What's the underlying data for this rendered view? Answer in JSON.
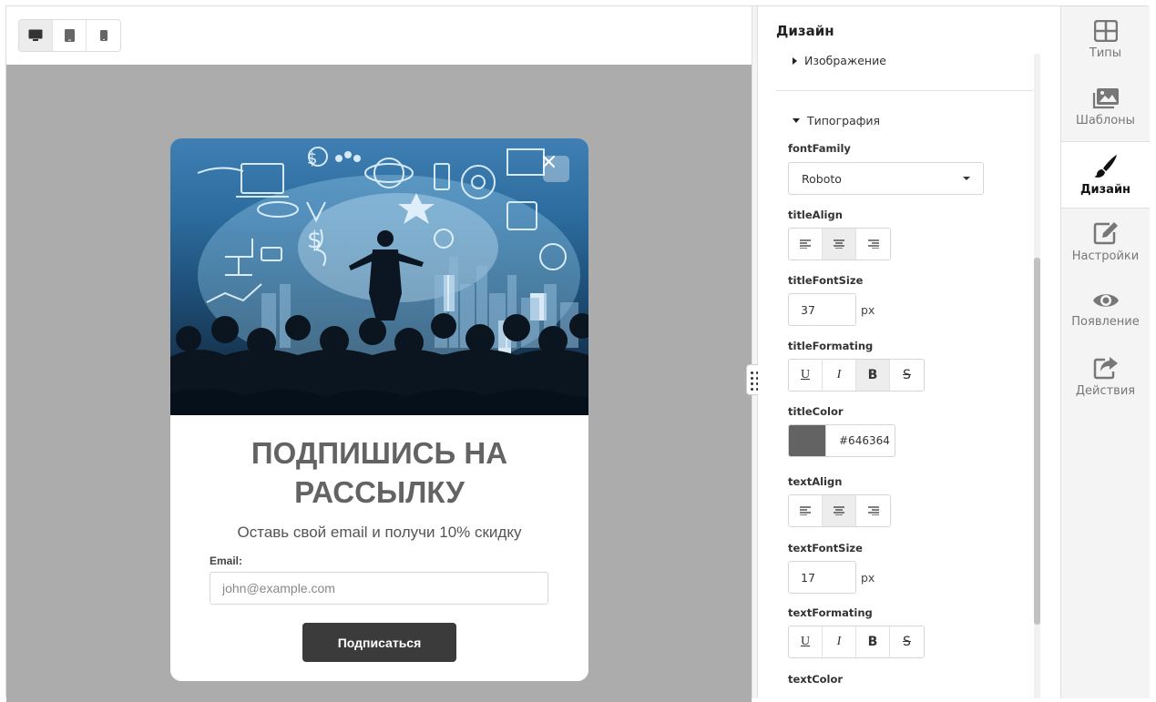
{
  "toolbar": {
    "devices": [
      {
        "icon": "desktop-icon",
        "active": true
      },
      {
        "icon": "tablet-icon",
        "active": false
      },
      {
        "icon": "mobile-icon",
        "active": false
      }
    ]
  },
  "popup": {
    "title": "ПОДПИШИСЬ НА РАССЫЛКУ",
    "text": "Оставь свой email и получи 10% скидку",
    "email_label": "Email:",
    "email_placeholder": "john@example.com",
    "button_label": "Подписаться",
    "title_color": "#646364"
  },
  "settings": {
    "title": "Дизайн",
    "sections": {
      "image": "Изображение",
      "typography": "Типография"
    },
    "fields": {
      "font_family_label": "fontFamily",
      "font_family_value": "Roboto",
      "title_align_label": "titleAlign",
      "title_font_size_label": "titleFontSize",
      "title_font_size_value": "37",
      "title_formatting_label": "titleFormating",
      "title_color_label": "titleColor",
      "title_color_value": "#646364",
      "text_align_label": "textAlign",
      "text_font_size_label": "textFontSize",
      "text_font_size_value": "17",
      "text_formatting_label": "textFormating",
      "text_color_label": "textColor",
      "unit": "px"
    }
  },
  "nav": {
    "items": [
      {
        "label": "Типы",
        "icon": "grid-icon"
      },
      {
        "label": "Шаблоны",
        "icon": "images-icon"
      },
      {
        "label": "Дизайн",
        "icon": "brush-icon",
        "active": true
      },
      {
        "label": "Настройки",
        "icon": "edit-icon"
      },
      {
        "label": "Появление",
        "icon": "eye-icon"
      },
      {
        "label": "Действия",
        "icon": "share-icon"
      }
    ]
  }
}
